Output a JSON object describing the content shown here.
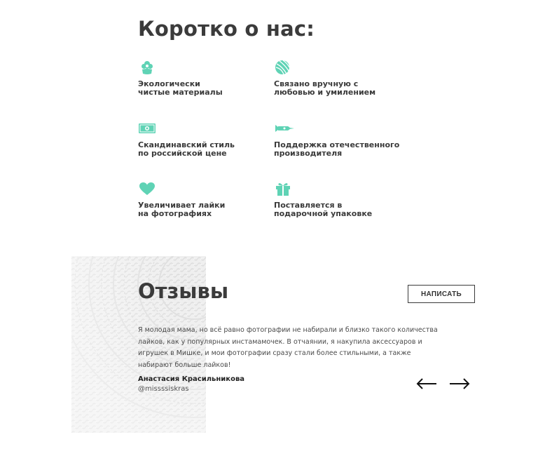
{
  "about": {
    "title": "Коротко о нас:",
    "features": [
      {
        "icon": "flower-icon",
        "line1": "Экологически",
        "line2": "чистые материалы"
      },
      {
        "icon": "yarn-ball-icon",
        "line1": "Связано вручную с",
        "line2": "любовью и умилением"
      },
      {
        "icon": "banknote-icon",
        "line1": "Скандинавский стиль",
        "line2": "по российской цене"
      },
      {
        "icon": "rocket-icon",
        "line1": "Поддержка отечественного",
        "line2": "производителя"
      },
      {
        "icon": "heart-icon",
        "line1": "Увеличивает лайки",
        "line2": "на фотографиях"
      },
      {
        "icon": "gift-icon",
        "line1": "Поставляется в",
        "line2": "подарочной упаковке"
      }
    ]
  },
  "reviews": {
    "title": "Отзывы",
    "write_label": "НАПИСАТЬ",
    "text": "Я молодая мама, но всё равно фотографии не набирали и близко такого количества лайков, как у популярных инстамамочек. В отчаянии, я накупила аксессуаров и игрушек в Мишке, и мои фотографии сразу стали более стильными, а также набирают больше лайков!",
    "author": "Анастасия Красильникова",
    "handle": "@missssiskras",
    "prev_icon": "arrow-left-icon",
    "next_icon": "arrow-right-icon"
  },
  "colors": {
    "accent": "#5fd3b5",
    "heading": "#3b3b3b",
    "text": "#4a4a4a"
  }
}
